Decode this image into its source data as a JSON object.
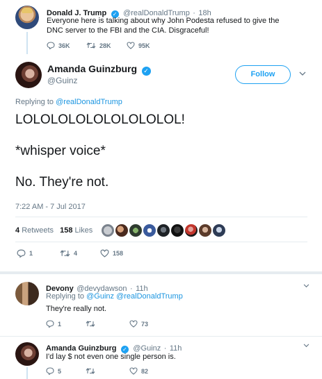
{
  "parent_tweet": {
    "name": "Donald J. Trump",
    "handle": "@realDonaldTrump",
    "time": "18h",
    "text": "Everyone here is talking about why John Podesta refused to give the DNC server to the FBI and the CIA. Disgraceful!",
    "replies": "36K",
    "retweets": "28K",
    "likes": "95K"
  },
  "main_tweet": {
    "name": "Amanda Guinzburg",
    "handle": "@Guinz",
    "follow_label": "Follow",
    "replying_to_prefix": "Replying to",
    "replying_to": "@realDonaldTrump",
    "lines": [
      "LOLOLOLOLOLOLOLOLOL!",
      "*whisper voice*",
      "No. They're not."
    ],
    "timestamp": "7:22 AM - 7 Jul 2017",
    "retweets_count": "4",
    "retweets_label": "Retweets",
    "likes_count": "158",
    "likes_label": "Likes",
    "replies": "1",
    "retweets": "4",
    "likes": "158"
  },
  "reply1": {
    "name": "Devony",
    "handle": "@devydawson",
    "time": "11h",
    "replying_to_prefix": "Replying to",
    "replying_to_1": "@Guinz",
    "replying_to_2": "@realDonaldTrump",
    "text": "They're really not.",
    "replies": "1",
    "retweets": "",
    "likes": "73"
  },
  "reply2": {
    "name": "Amanda Guinzburg",
    "handle": "@Guinz",
    "time": "11h",
    "text": "I'd lay $ not even one single person is.",
    "replies": "5",
    "retweets": "",
    "likes": "82"
  },
  "colors": {
    "accent": "#1da1f2",
    "link": "#1b95e0",
    "secondary": "#657786",
    "thread": "#cfe3f1"
  }
}
